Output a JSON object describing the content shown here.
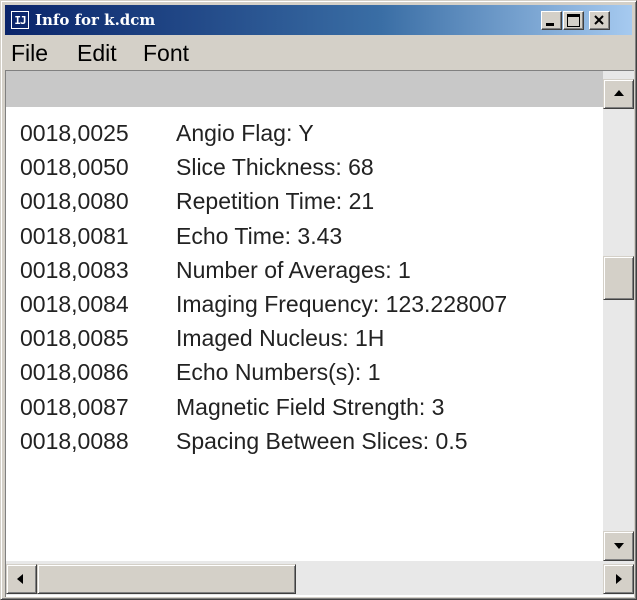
{
  "window": {
    "title": "Info for k.dcm",
    "icon_glyph": "IJ",
    "controls": [
      "minimize-icon",
      "maximize-icon",
      "close-icon"
    ]
  },
  "menu": {
    "items": [
      "File",
      "Edit",
      "Font"
    ]
  },
  "table": {
    "header": "",
    "rows": [
      {
        "tag": "0018,0025",
        "desc": "Angio Flag: Y"
      },
      {
        "tag": "0018,0050",
        "desc": "Slice Thickness: 68"
      },
      {
        "tag": "0018,0080",
        "desc": "Repetition Time: 21"
      },
      {
        "tag": "0018,0081",
        "desc": "Echo Time: 3.43"
      },
      {
        "tag": "0018,0083",
        "desc": "Number of Averages: 1"
      },
      {
        "tag": "0018,0084",
        "desc": "Imaging Frequency: 123.228007"
      },
      {
        "tag": "0018,0085",
        "desc": "Imaged Nucleus: 1H"
      },
      {
        "tag": "0018,0086",
        "desc": "Echo Numbers(s): 1"
      },
      {
        "tag": "0018,0087",
        "desc": "Magnetic Field Strength: 3"
      },
      {
        "tag": "0018,0088",
        "desc": "Spacing Between Slices: 0.5"
      }
    ]
  },
  "colors": {
    "title_gradient_start": "#0a246a",
    "title_gradient_end": "#a6caf0",
    "chrome": "#d4d0c8",
    "header_strip": "#c8c8c8"
  }
}
